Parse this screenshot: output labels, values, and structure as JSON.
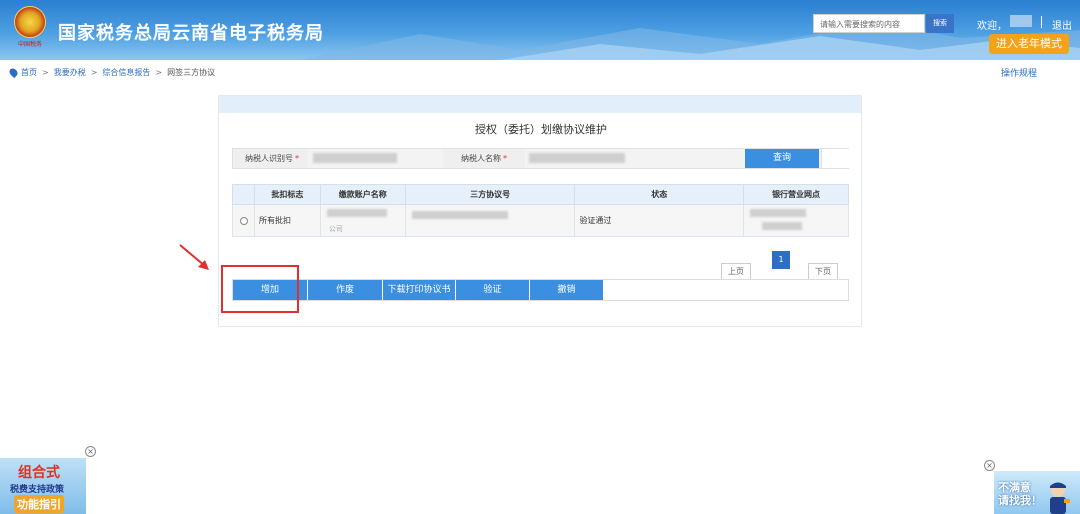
{
  "header": {
    "site_title": "国家税务总局云南省电子税务局",
    "emblem_caption": "中国税务",
    "search_placeholder": "请输入需要搜索的内容",
    "search_button": "搜索",
    "welcome": "欢迎，",
    "logout": "退出",
    "elder_mode": "进入老年模式"
  },
  "breadcrumb": {
    "items": [
      "首页",
      "我要办税",
      "综合信息报告",
      "网签三方协议"
    ],
    "separator": ">"
  },
  "ops_link": "操作规程",
  "panel": {
    "title": "授权（委托）划缴协议维护",
    "taxpayer_id_label": "纳税人识别号",
    "taxpayer_name_label": "纳税人名称",
    "required_mark": "*",
    "query_button": "查询"
  },
  "table": {
    "columns": [
      "",
      "批扣标志",
      "缴款账户名称",
      "三方协议号",
      "状态",
      "银行营业网点"
    ],
    "rows": [
      {
        "flag": "所有批扣",
        "account_suffix": "公司",
        "protocol": "",
        "status": "验证通过",
        "bank": ""
      }
    ]
  },
  "pagination": {
    "current": "1",
    "prev": "上页",
    "next": "下页"
  },
  "actions": {
    "add": "增加",
    "void": "作废",
    "download": "下载打印协议书",
    "verify": "验证",
    "revoke": "撤销"
  },
  "float_left": {
    "line1": "组合式",
    "line2": "税费支持政策",
    "line3": "功能指引"
  },
  "float_right": {
    "line1": "不满意",
    "line2": "请找我！"
  },
  "colors": {
    "header_blue": "#2a7fd0",
    "button_blue": "#3b8fe0",
    "elder_orange": "#f5a21b",
    "highlight_red": "#e03030"
  }
}
